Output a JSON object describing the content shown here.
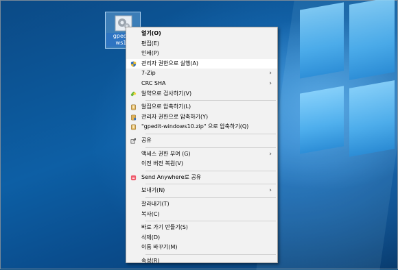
{
  "desktop_icon": {
    "label": "gpedit-windows10",
    "label_line1": "gpedit-",
    "label_line2": "ws10"
  },
  "menu": {
    "groups": [
      [
        {
          "label": "열기(O)",
          "bold": true,
          "icon": ""
        },
        {
          "label": "편집(E)",
          "icon": ""
        },
        {
          "label": "인쇄(P)",
          "icon": ""
        },
        {
          "label": "관리자 권한으로 실행(A)",
          "icon": "uac-shield-icon",
          "highlight": true
        },
        {
          "label": "7-Zip",
          "submenu": true,
          "icon": ""
        },
        {
          "label": "CRC SHA",
          "submenu": true,
          "icon": ""
        },
        {
          "label": "알약으로 검사하기(V)",
          "icon": "alyac-icon"
        }
      ],
      [
        {
          "label": "알집으로 압축하기(L)",
          "icon": "alzip-icon"
        },
        {
          "label": "관리자 권한으로 압축하기(Y)",
          "icon": "alzip-admin-icon"
        },
        {
          "label": "\"gpedit-windows10.zip\" 으로 압축하기(Q)",
          "icon": "alzip-icon"
        }
      ],
      [
        {
          "label": "공유",
          "icon": "share-icon"
        }
      ],
      [
        {
          "label": "액세스 권한 부여 (G)",
          "submenu": true,
          "icon": ""
        },
        {
          "label": "이전 버전 복원(V)",
          "icon": ""
        }
      ],
      [
        {
          "label": "Send Anywhere로 공유",
          "icon": "send-anywhere-icon"
        }
      ],
      [
        {
          "label": "보내기(N)",
          "submenu": true,
          "icon": ""
        }
      ],
      [
        {
          "label": "잘라내기(T)",
          "icon": ""
        },
        {
          "label": "복사(C)",
          "icon": ""
        }
      ],
      [
        {
          "label": "바로 가기 만들기(S)",
          "icon": ""
        },
        {
          "label": "삭제(D)",
          "icon": ""
        },
        {
          "label": "이름 바꾸기(M)",
          "icon": ""
        }
      ],
      [
        {
          "label": "속성(R)",
          "icon": ""
        }
      ]
    ]
  }
}
